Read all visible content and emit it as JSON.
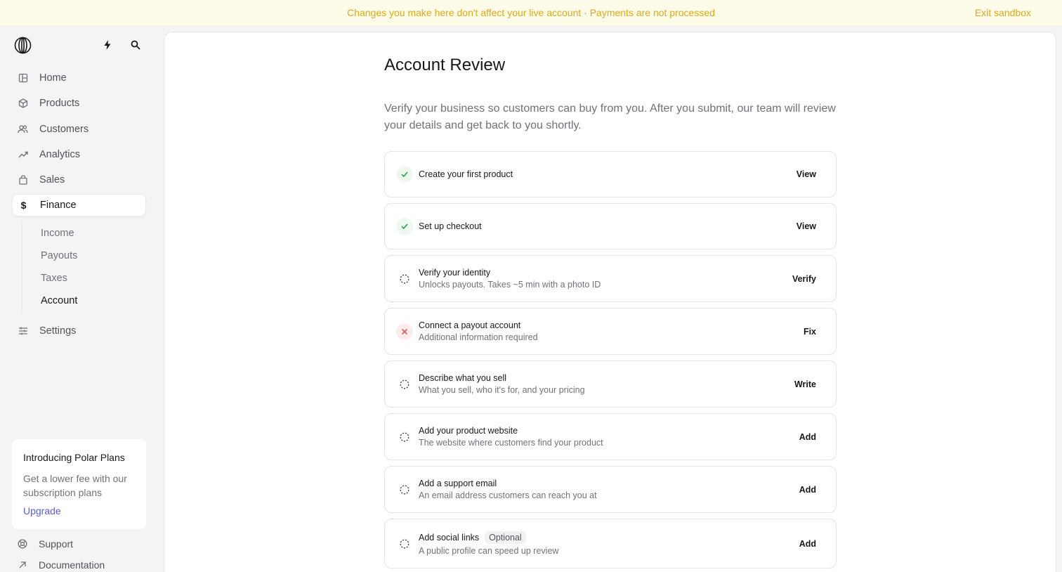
{
  "banner": {
    "message": "Changes you make here don't affect your live account · Payments are not processed",
    "exit_label": "Exit sandbox"
  },
  "sidebar": {
    "items": [
      {
        "label": "Home",
        "icon": "home-icon"
      },
      {
        "label": "Products",
        "icon": "products-icon"
      },
      {
        "label": "Customers",
        "icon": "customers-icon"
      },
      {
        "label": "Analytics",
        "icon": "analytics-icon"
      },
      {
        "label": "Sales",
        "icon": "shopping-bag-icon"
      },
      {
        "label": "Finance",
        "icon": "dollar-icon"
      }
    ],
    "finance_sub": [
      {
        "label": "Income"
      },
      {
        "label": "Payouts"
      },
      {
        "label": "Taxes"
      },
      {
        "label": "Account"
      }
    ],
    "settings_label": "Settings",
    "promo": {
      "title": "Introducing Polar Plans",
      "text": "Get a lower fee with our subscription plans",
      "cta": "Upgrade"
    },
    "support_label": "Support",
    "docs_label": "Documentation"
  },
  "main": {
    "title": "Account Review",
    "description": "Verify your business so customers can buy from you. After you submit, our team will review your details and get back to you shortly.",
    "tasks": [
      {
        "title": "Create your first product",
        "subtitle": "",
        "action": "View",
        "status": "done"
      },
      {
        "title": "Set up checkout",
        "subtitle": "",
        "action": "View",
        "status": "done"
      },
      {
        "title": "Verify your identity",
        "subtitle": "Unlocks payouts. Takes ~5 min with a photo ID",
        "action": "Verify",
        "status": "pending"
      },
      {
        "title": "Connect a payout account",
        "subtitle": "Additional information required",
        "action": "Fix",
        "status": "error"
      },
      {
        "title": "Describe what you sell",
        "subtitle": "What you sell, who it's for, and your pricing",
        "action": "Write",
        "status": "pending"
      },
      {
        "title": "Add your product website",
        "subtitle": "The website where customers find your product",
        "action": "Add",
        "status": "pending"
      },
      {
        "title": "Add a support email",
        "subtitle": "An email address customers can reach you at",
        "action": "Add",
        "status": "pending"
      },
      {
        "title": "Add social links",
        "badge": "Optional",
        "subtitle": "A public profile can speed up review",
        "action": "Add",
        "status": "pending"
      }
    ]
  },
  "colors": {
    "banner_text": "#e0a915",
    "banner_bg": "#fefbe8",
    "success": "#22a04b",
    "error": "#e5484d",
    "link": "#5b5bd6"
  }
}
